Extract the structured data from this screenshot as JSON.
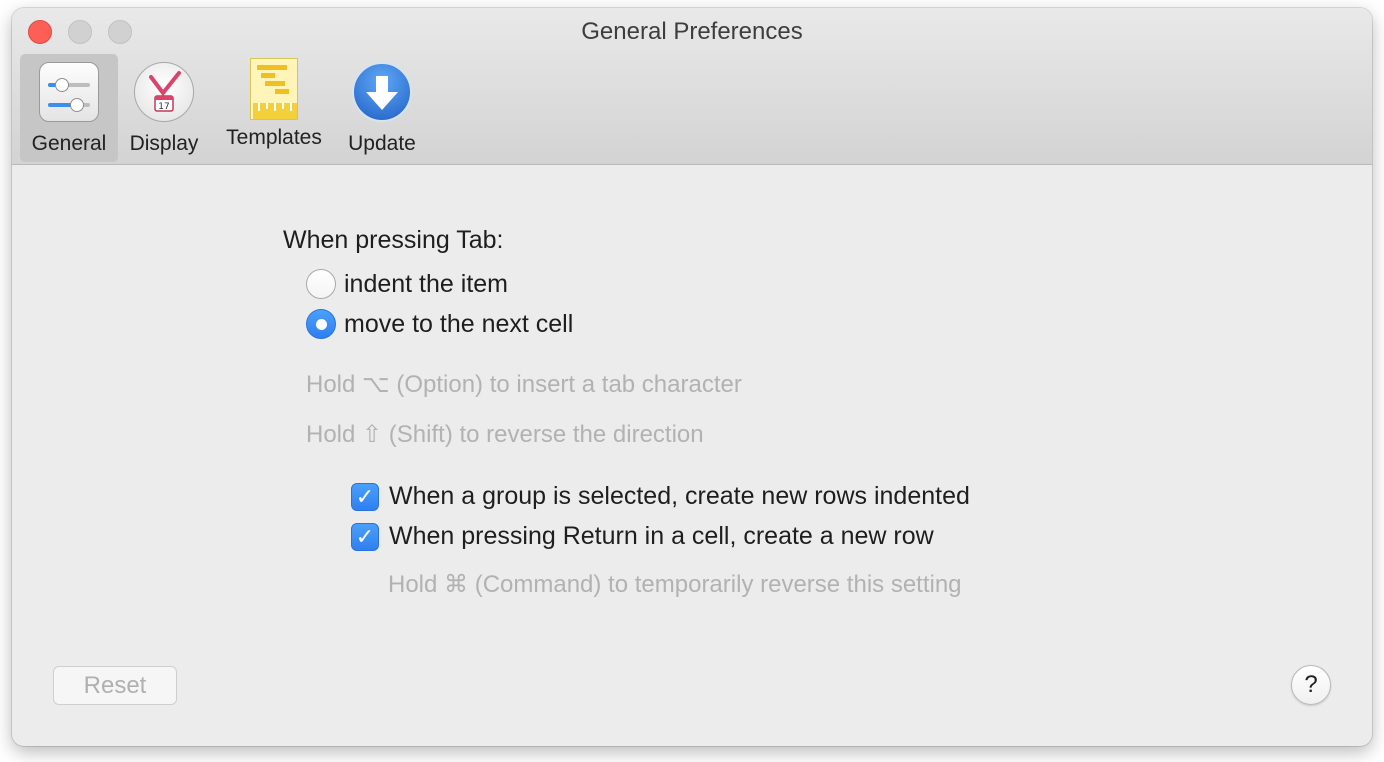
{
  "window": {
    "title": "General Preferences"
  },
  "toolbar": {
    "items": [
      {
        "label": "General",
        "icon": "sliders-icon",
        "selected": true
      },
      {
        "label": "Display",
        "icon": "calendar-clock-icon",
        "selected": false
      },
      {
        "label": "Templates",
        "icon": "gantt-template-icon",
        "selected": false
      },
      {
        "label": "Update",
        "icon": "download-arrow-icon",
        "selected": false
      }
    ]
  },
  "tab_behavior": {
    "heading": "When pressing Tab:",
    "options": [
      {
        "label": "indent the item",
        "selected": false
      },
      {
        "label": "move to the next cell",
        "selected": true
      }
    ],
    "hint_option": "Hold ⌥ (Option) to insert a tab character",
    "hint_shift": "Hold ⇧ (Shift) to reverse the direction"
  },
  "checkboxes": [
    {
      "label": "When a group is selected, create new rows indented",
      "checked": true
    },
    {
      "label": "When pressing Return in a cell, create a new row",
      "checked": true
    }
  ],
  "hint_command": "Hold ⌘ (Command) to temporarily reverse this setting",
  "footer": {
    "reset_label": "Reset",
    "help_label": "?"
  },
  "colors": {
    "accent": "#3b8ef0",
    "close": "#fd5f57",
    "hint_text": "#b2b2b2"
  }
}
